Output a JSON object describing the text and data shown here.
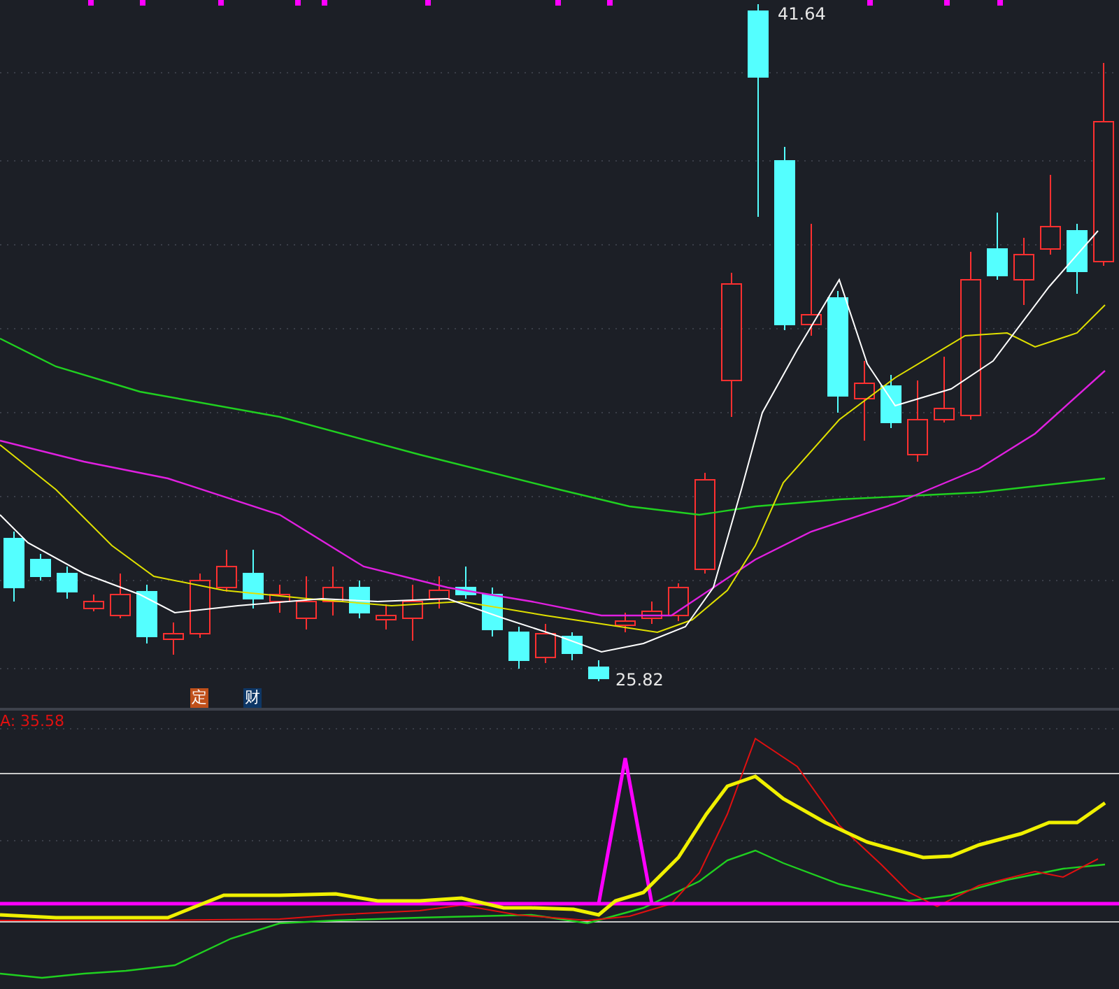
{
  "price_chart": {
    "high_label": "41.64",
    "low_label": "25.82",
    "event_markers": [
      {
        "label": "定",
        "color": "#c0501a"
      },
      {
        "label": "财",
        "color": "#0e3766"
      }
    ]
  },
  "indicator_panel": {
    "readout": "A: 35.58"
  }
}
